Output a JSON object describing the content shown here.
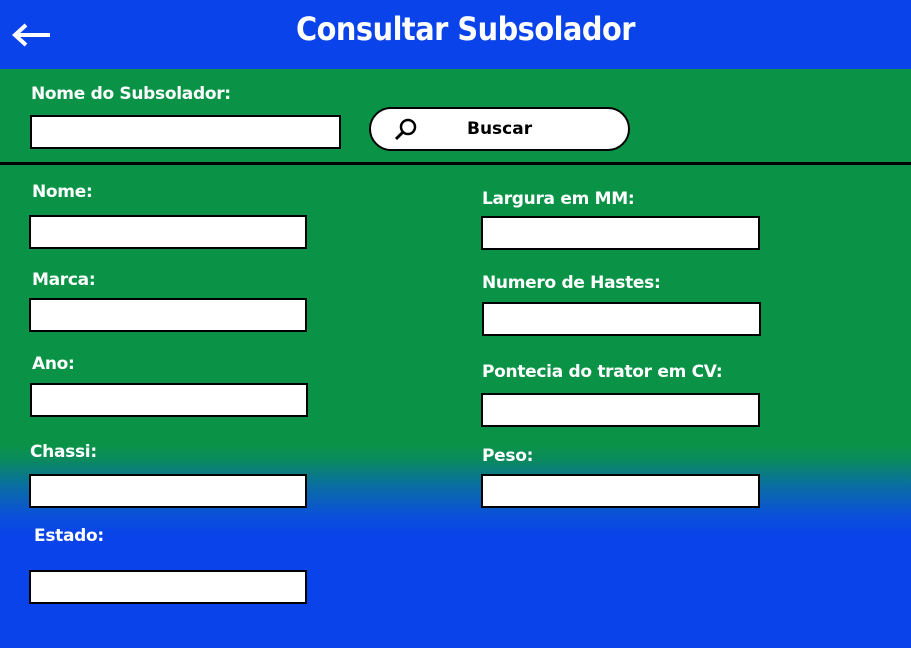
{
  "header": {
    "title": "Consultar Subsolador",
    "back_icon": "arrow-left-icon"
  },
  "search": {
    "label": "Nome do Subsolador:",
    "value": "",
    "button_label": "Buscar",
    "button_icon": "magnifier-icon"
  },
  "form": {
    "left": [
      {
        "label": "Nome:",
        "value": ""
      },
      {
        "label": "Marca:",
        "value": ""
      },
      {
        "label": "Ano:",
        "value": ""
      },
      {
        "label": "Chassi:",
        "value": ""
      },
      {
        "label": "Estado:",
        "value": ""
      }
    ],
    "right": [
      {
        "label": "Largura em MM:",
        "value": ""
      },
      {
        "label": "Numero de Hastes:",
        "value": ""
      },
      {
        "label": "Pontecia do trator em CV:",
        "value": ""
      },
      {
        "label": "Peso:",
        "value": ""
      }
    ]
  },
  "colors": {
    "header_bg": "#0a43ea",
    "form_bg": "#0a9347",
    "text": "#ffffff"
  }
}
